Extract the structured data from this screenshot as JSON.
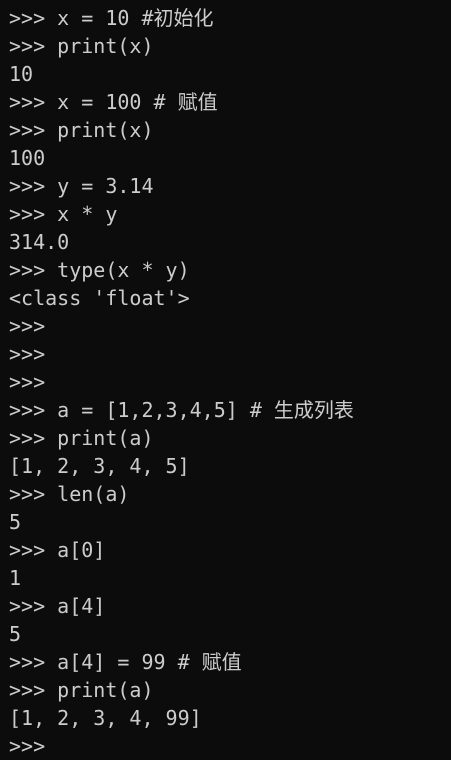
{
  "terminal": {
    "background": "#0c0c0c",
    "foreground": "#cccccc",
    "lines": [
      {
        "type": "input",
        "text": ">>> x = 10 #初始化"
      },
      {
        "type": "input",
        "text": ">>> print(x)"
      },
      {
        "type": "output",
        "text": "10"
      },
      {
        "type": "input",
        "text": ">>> x = 100 # 赋值"
      },
      {
        "type": "input",
        "text": ">>> print(x)"
      },
      {
        "type": "output",
        "text": "100"
      },
      {
        "type": "input",
        "text": ">>> y = 3.14"
      },
      {
        "type": "input",
        "text": ">>> x * y"
      },
      {
        "type": "output",
        "text": "314.0"
      },
      {
        "type": "input",
        "text": ">>> type(x * y)"
      },
      {
        "type": "output",
        "text": "<class 'float'>"
      },
      {
        "type": "input",
        "text": ">>>"
      },
      {
        "type": "input",
        "text": ">>>"
      },
      {
        "type": "input",
        "text": ">>>"
      },
      {
        "type": "input",
        "text": ">>> a = [1,2,3,4,5] # 生成列表"
      },
      {
        "type": "input",
        "text": ">>> print(a)"
      },
      {
        "type": "output",
        "text": "[1, 2, 3, 4, 5]"
      },
      {
        "type": "input",
        "text": ">>> len(a)"
      },
      {
        "type": "output",
        "text": "5"
      },
      {
        "type": "input",
        "text": ">>> a[0]"
      },
      {
        "type": "output",
        "text": "1"
      },
      {
        "type": "input",
        "text": ">>> a[4]"
      },
      {
        "type": "output",
        "text": "5"
      },
      {
        "type": "input",
        "text": ">>> a[4] = 99 # 赋值"
      },
      {
        "type": "input",
        "text": ">>> print(a)"
      },
      {
        "type": "output",
        "text": "[1, 2, 3, 4, 99]"
      },
      {
        "type": "input",
        "text": ">>>"
      }
    ]
  }
}
